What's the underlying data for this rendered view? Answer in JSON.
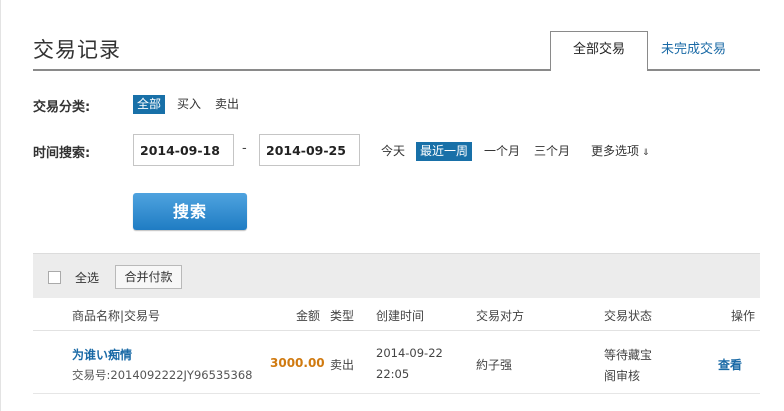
{
  "header": {
    "title": "交易记录",
    "tabs": [
      {
        "label": "全部交易",
        "active": true
      },
      {
        "label": "未完成交易",
        "active": false
      }
    ]
  },
  "filters": {
    "category_label": "交易分类:",
    "category_options": [
      {
        "label": "全部",
        "selected": true
      },
      {
        "label": "买入",
        "selected": false
      },
      {
        "label": "卖出",
        "selected": false
      }
    ],
    "time_label": "时间搜索:",
    "start_date": "2014-09-18",
    "separator": "-",
    "end_date": "2014-09-25",
    "time_options": [
      {
        "label": "今天",
        "selected": false
      },
      {
        "label": "最近一周",
        "selected": true
      },
      {
        "label": "一个月",
        "selected": false
      },
      {
        "label": "三个月",
        "selected": false
      }
    ],
    "more_options_label": "更多选项",
    "more_options_icon": "double-chevron-down-icon",
    "search_button": "搜索"
  },
  "toolbar": {
    "select_all_label": "全选",
    "merge_pay_label": "合并付款"
  },
  "table": {
    "columns": {
      "product": "商品名称|交易号",
      "amount": "金额",
      "type": "类型",
      "created": "创建时间",
      "counterparty": "交易对方",
      "status": "交易状态",
      "action": "操作"
    },
    "rows": [
      {
        "product_name": "为谁い痴情",
        "order_no": "交易号:2014092222JY96535368",
        "amount": "3000.00",
        "type": "卖出",
        "created_date": "2014-09-22",
        "created_time": "22:05",
        "counterparty": "約子强",
        "status_line1": "等待藏宝",
        "status_line2": "阁审核",
        "action": "查看"
      }
    ]
  },
  "colors": {
    "accent": "#1870a8",
    "link": "#1a6aa6",
    "amount": "#d07a10",
    "button": "#2f8bd0"
  }
}
